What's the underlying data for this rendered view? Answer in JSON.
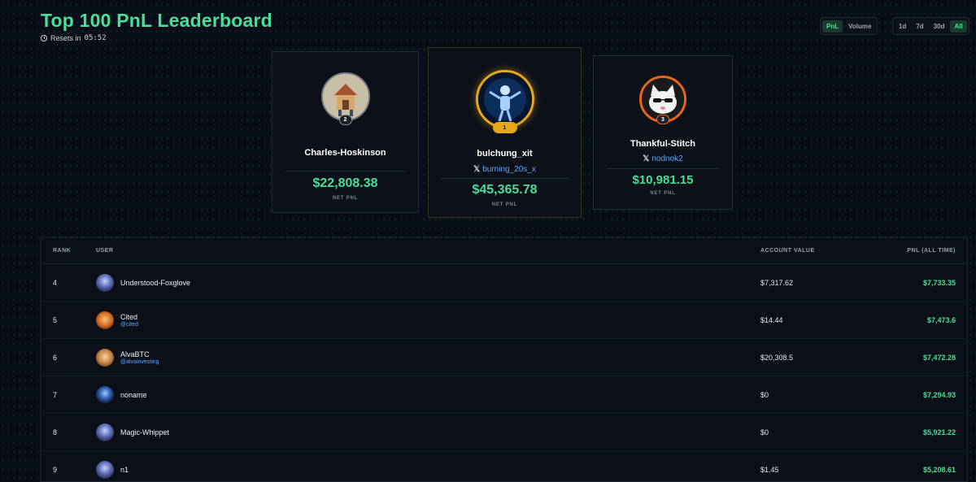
{
  "header": {
    "title": "Top 100 PnL Leaderboard",
    "resets_label": "Resets in",
    "resets_timer": "05:52"
  },
  "filters": {
    "metric": [
      "PnL",
      "Volume"
    ],
    "metric_active": "PnL",
    "range": [
      "1d",
      "7d",
      "30d",
      "All"
    ],
    "range_active": "All"
  },
  "podium": {
    "first": {
      "rank": "1",
      "name": "bulchung_xit",
      "handle": "burning_20s_x",
      "pnl": "$45,365.78",
      "pnl_label": "NET PNL"
    },
    "second": {
      "rank": "2",
      "name": "Charles-Hoskinson",
      "pnl": "$22,808.38",
      "pnl_label": "NET PNL"
    },
    "third": {
      "rank": "3",
      "name": "Thankful-Stitch",
      "handle": "nodnok2",
      "pnl": "$10,981.15",
      "pnl_label": "NET PNL"
    }
  },
  "table": {
    "headers": {
      "rank": "RANK",
      "user": "USER",
      "account_value": "ACCOUNT VALUE",
      "pnl": "PNL (ALL TIME)"
    },
    "rows": [
      {
        "rank": "4",
        "name": "Understood-Foxglove",
        "handle": "",
        "account_value": "$7,317.62",
        "pnl": "$7,733.35"
      },
      {
        "rank": "5",
        "name": "Cited",
        "handle": "@cited",
        "account_value": "$14.44",
        "pnl": "$7,473.6"
      },
      {
        "rank": "6",
        "name": "AlvaBTC",
        "handle": "@alvainvesting",
        "account_value": "$20,308.5",
        "pnl": "$7,472.28"
      },
      {
        "rank": "7",
        "name": "noname",
        "handle": "",
        "account_value": "$0",
        "pnl": "$7,294.93"
      },
      {
        "rank": "8",
        "name": "Magic-Whippet",
        "handle": "",
        "account_value": "$0",
        "pnl": "$5,921.22"
      },
      {
        "rank": "9",
        "name": "n1",
        "handle": "",
        "account_value": "$1.45",
        "pnl": "$5,208.61"
      }
    ]
  },
  "colors": {
    "accent_green": "#4ade9a",
    "link_blue": "#60a5fa",
    "gold": "#e6a817",
    "bronze": "#e8661a"
  }
}
